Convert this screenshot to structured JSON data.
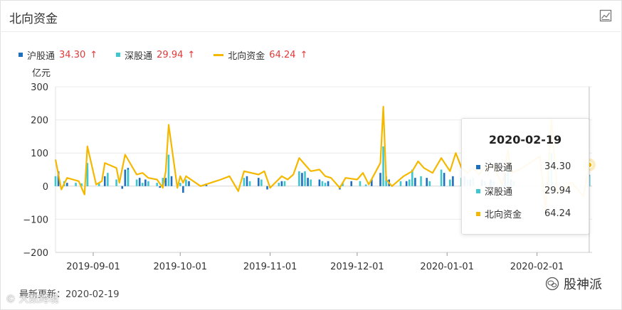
{
  "panel": {
    "title": "北向资金",
    "footer_label": "最新更新：",
    "footer_date": "2020-02-19",
    "watermark_left": "© 大数跨境",
    "watermark_right": "股神派"
  },
  "legend": [
    {
      "name": "沪股通",
      "value": "34.30",
      "arrow": "↑",
      "color": "#1f6fbf",
      "kind": "square"
    },
    {
      "name": "深股通",
      "value": "29.94",
      "arrow": "↑",
      "color": "#3ec7cf",
      "kind": "square"
    },
    {
      "name": "北向资金",
      "value": "64.24",
      "arrow": "↑",
      "color": "#f5b800",
      "kind": "line"
    }
  ],
  "tooltip": {
    "date": "2020-02-19",
    "rows": [
      {
        "name": "沪股通",
        "value": "34.30",
        "color": "#1f6fbf"
      },
      {
        "name": "深股通",
        "value": "29.94",
        "color": "#3ec7cf"
      },
      {
        "name": "北向资金",
        "value": "64.24",
        "color": "#f5b800"
      }
    ]
  },
  "chart_data": {
    "type": "bar",
    "ylabel": "亿元",
    "ylim": [
      -200,
      300
    ],
    "yticks": [
      300,
      200,
      100,
      0,
      -100,
      -200
    ],
    "xticks": [
      "2019-09-01",
      "2019-10-01",
      "2019-11-01",
      "2019-12-01",
      "2020-01-01",
      "2020-02-01"
    ],
    "xlim": [
      "2019-08-19",
      "2020-02-20"
    ],
    "grid": "horizontal",
    "legend_position": "top-left",
    "series": [
      {
        "name": "北向资金",
        "type": "line",
        "color": "#f5b800",
        "points": [
          [
            "2019-08-19",
            80
          ],
          [
            "2019-08-21",
            -10
          ],
          [
            "2019-08-23",
            25
          ],
          [
            "2019-08-27",
            15
          ],
          [
            "2019-08-29",
            -25
          ],
          [
            "2019-08-30",
            120
          ],
          [
            "2019-09-02",
            5
          ],
          [
            "2019-09-04",
            15
          ],
          [
            "2019-09-05",
            70
          ],
          [
            "2019-09-09",
            55
          ],
          [
            "2019-09-10",
            10
          ],
          [
            "2019-09-12",
            95
          ],
          [
            "2019-09-16",
            35
          ],
          [
            "2019-09-18",
            40
          ],
          [
            "2019-09-20",
            25
          ],
          [
            "2019-09-23",
            20
          ],
          [
            "2019-09-25",
            -5
          ],
          [
            "2019-09-26",
            45
          ],
          [
            "2019-09-27",
            185
          ],
          [
            "2019-09-30",
            -5
          ],
          [
            "2019-10-01",
            30
          ],
          [
            "2019-10-02",
            10
          ],
          [
            "2019-10-03",
            30
          ],
          [
            "2019-10-08",
            0
          ],
          [
            "2019-10-15",
            20
          ],
          [
            "2019-10-18",
            30
          ],
          [
            "2019-10-21",
            -15
          ],
          [
            "2019-10-23",
            45
          ],
          [
            "2019-10-28",
            35
          ],
          [
            "2019-10-30",
            45
          ],
          [
            "2019-11-01",
            -5
          ],
          [
            "2019-11-05",
            30
          ],
          [
            "2019-11-07",
            20
          ],
          [
            "2019-11-09",
            35
          ],
          [
            "2019-11-11",
            85
          ],
          [
            "2019-11-13",
            65
          ],
          [
            "2019-11-15",
            45
          ],
          [
            "2019-11-18",
            50
          ],
          [
            "2019-11-20",
            30
          ],
          [
            "2019-11-22",
            25
          ],
          [
            "2019-11-25",
            -5
          ],
          [
            "2019-11-27",
            25
          ],
          [
            "2019-12-01",
            20
          ],
          [
            "2019-12-03",
            40
          ],
          [
            "2019-12-05",
            5
          ],
          [
            "2019-12-09",
            70
          ],
          [
            "2019-12-10",
            240
          ],
          [
            "2019-12-11",
            20
          ],
          [
            "2019-12-13",
            0
          ],
          [
            "2019-12-17",
            30
          ],
          [
            "2019-12-20",
            45
          ],
          [
            "2019-12-22",
            75
          ],
          [
            "2019-12-24",
            55
          ],
          [
            "2019-12-27",
            40
          ],
          [
            "2019-12-30",
            85
          ],
          [
            "2020-01-02",
            45
          ],
          [
            "2020-01-04",
            100
          ],
          [
            "2020-01-06",
            55
          ],
          [
            "2020-01-08",
            40
          ],
          [
            "2020-01-10",
            55
          ],
          [
            "2020-01-12",
            35
          ],
          [
            "2020-01-14",
            55
          ],
          [
            "2020-01-17",
            60
          ],
          [
            "2020-01-20",
            5
          ],
          [
            "2020-01-22",
            110
          ],
          [
            "2020-01-23",
            40
          ],
          [
            "2020-01-26",
            50
          ],
          [
            "2020-02-02",
            90
          ],
          [
            "2020-02-04",
            -70
          ],
          [
            "2020-02-06",
            200
          ],
          [
            "2020-02-08",
            -20
          ],
          [
            "2020-02-13",
            10
          ],
          [
            "2020-02-17",
            -30
          ],
          [
            "2020-02-19",
            64.24
          ]
        ]
      },
      {
        "name": "沪股通",
        "type": "bar",
        "color": "#1f6fbf",
        "points": [
          [
            "2019-08-20",
            45
          ],
          [
            "2019-08-23",
            10
          ],
          [
            "2019-08-30",
            50
          ],
          [
            "2019-09-05",
            30
          ],
          [
            "2019-09-11",
            -8
          ],
          [
            "2019-09-12",
            50
          ],
          [
            "2019-09-13",
            55
          ],
          [
            "2019-09-17",
            25
          ],
          [
            "2019-09-19",
            20
          ],
          [
            "2019-09-24",
            -5
          ],
          [
            "2019-09-26",
            25
          ],
          [
            "2019-09-28",
            30
          ],
          [
            "2019-10-02",
            -20
          ],
          [
            "2019-10-04",
            15
          ],
          [
            "2019-10-10",
            8
          ],
          [
            "2019-10-24",
            30
          ],
          [
            "2019-10-28",
            25
          ],
          [
            "2019-10-31",
            -10
          ],
          [
            "2019-11-05",
            15
          ],
          [
            "2019-11-12",
            40
          ],
          [
            "2019-11-14",
            25
          ],
          [
            "2019-11-18",
            20
          ],
          [
            "2019-11-21",
            15
          ],
          [
            "2019-11-25",
            -10
          ],
          [
            "2019-11-29",
            15
          ],
          [
            "2019-12-06",
            20
          ],
          [
            "2019-12-09",
            40
          ],
          [
            "2019-12-12",
            20
          ],
          [
            "2019-12-18",
            15
          ],
          [
            "2019-12-21",
            25
          ],
          [
            "2019-12-25",
            25
          ],
          [
            "2019-12-31",
            40
          ],
          [
            "2020-01-03",
            30
          ],
          [
            "2020-01-07",
            30
          ],
          [
            "2020-01-09",
            20
          ],
          [
            "2020-01-13",
            20
          ],
          [
            "2020-01-16",
            20
          ],
          [
            "2020-01-21",
            40
          ],
          [
            "2020-01-23",
            20
          ],
          [
            "2020-02-19",
            34.3
          ]
        ]
      },
      {
        "name": "深股通",
        "type": "bar",
        "color": "#3ec7cf",
        "points": [
          [
            "2019-08-19",
            30
          ],
          [
            "2019-08-22",
            15
          ],
          [
            "2019-08-26",
            10
          ],
          [
            "2019-08-28",
            8
          ],
          [
            "2019-08-30",
            70
          ],
          [
            "2019-09-03",
            10
          ],
          [
            "2019-09-06",
            40
          ],
          [
            "2019-09-09",
            20
          ],
          [
            "2019-09-13",
            50
          ],
          [
            "2019-09-16",
            20
          ],
          [
            "2019-09-18",
            10
          ],
          [
            "2019-09-20",
            15
          ],
          [
            "2019-09-23",
            10
          ],
          [
            "2019-09-25",
            25
          ],
          [
            "2019-09-27",
            95
          ],
          [
            "2019-10-01",
            10
          ],
          [
            "2019-10-03",
            20
          ],
          [
            "2019-10-09",
            5
          ],
          [
            "2019-10-23",
            25
          ],
          [
            "2019-10-25",
            15
          ],
          [
            "2019-10-29",
            20
          ],
          [
            "2019-11-04",
            10
          ],
          [
            "2019-11-06",
            15
          ],
          [
            "2019-11-11",
            45
          ],
          [
            "2019-11-13",
            45
          ],
          [
            "2019-11-15",
            20
          ],
          [
            "2019-11-19",
            15
          ],
          [
            "2019-11-20",
            10
          ],
          [
            "2019-11-26",
            10
          ],
          [
            "2019-12-02",
            15
          ],
          [
            "2019-12-04",
            5
          ],
          [
            "2019-12-10",
            120
          ],
          [
            "2019-12-11",
            30
          ],
          [
            "2019-12-16",
            15
          ],
          [
            "2019-12-19",
            20
          ],
          [
            "2019-12-20",
            50
          ],
          [
            "2019-12-23",
            30
          ],
          [
            "2019-12-26",
            15
          ],
          [
            "2019-12-30",
            50
          ],
          [
            "2020-01-02",
            20
          ],
          [
            "2020-01-06",
            25
          ],
          [
            "2020-01-08",
            20
          ],
          [
            "2020-01-10",
            25
          ],
          [
            "2020-01-14",
            15
          ],
          [
            "2020-01-17",
            15
          ],
          [
            "2020-01-20",
            10
          ],
          [
            "2020-01-22",
            55
          ],
          [
            "2020-01-24",
            15
          ],
          [
            "2020-02-05",
            45
          ],
          [
            "2020-02-06",
            100
          ],
          [
            "2020-02-19",
            29.94
          ]
        ]
      }
    ]
  }
}
